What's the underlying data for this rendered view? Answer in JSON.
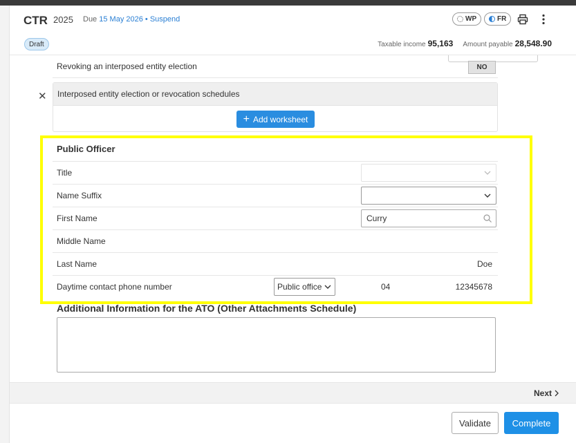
{
  "header": {
    "title": "CTR",
    "year": "2025",
    "due_prefix": "Due",
    "due_date": "15 May 2026",
    "separator": "•",
    "suspend_label": "Suspend",
    "wp_label": "WP",
    "fr_label": "FR",
    "status_badge": "Draft",
    "taxable_income_label": "Taxable income",
    "taxable_income_value": "95,163",
    "amount_payable_label": "Amount payable",
    "amount_payable_value": "28,548.90"
  },
  "interposed": {
    "revoking_label": "Revoking an interposed entity election",
    "revoking_value": "NO",
    "schedules_label": "Interposed entity election or revocation schedules",
    "add_worksheet_label": "Add worksheet"
  },
  "public_officer": {
    "title": "Public Officer",
    "title_label": "Title",
    "title_value": "",
    "name_suffix_label": "Name Suffix",
    "name_suffix_value": "",
    "first_name_label": "First Name",
    "first_name_value": "Curry",
    "middle_name_label": "Middle Name",
    "last_name_label": "Last Name",
    "last_name_value": "Doe",
    "phone_label": "Daytime contact phone number",
    "phone_type": "Public office",
    "phone_area": "04",
    "phone_number": "12345678"
  },
  "additional_info": {
    "title": "Additional Information for the ATO (Other Attachments Schedule)",
    "value": ""
  },
  "footer": {
    "next_label": "Next",
    "validate_label": "Validate",
    "complete_label": "Complete"
  },
  "colors": {
    "accent": "#1e90e6",
    "highlight": "#ffff00",
    "draft_badge": "#d9ebf9"
  }
}
